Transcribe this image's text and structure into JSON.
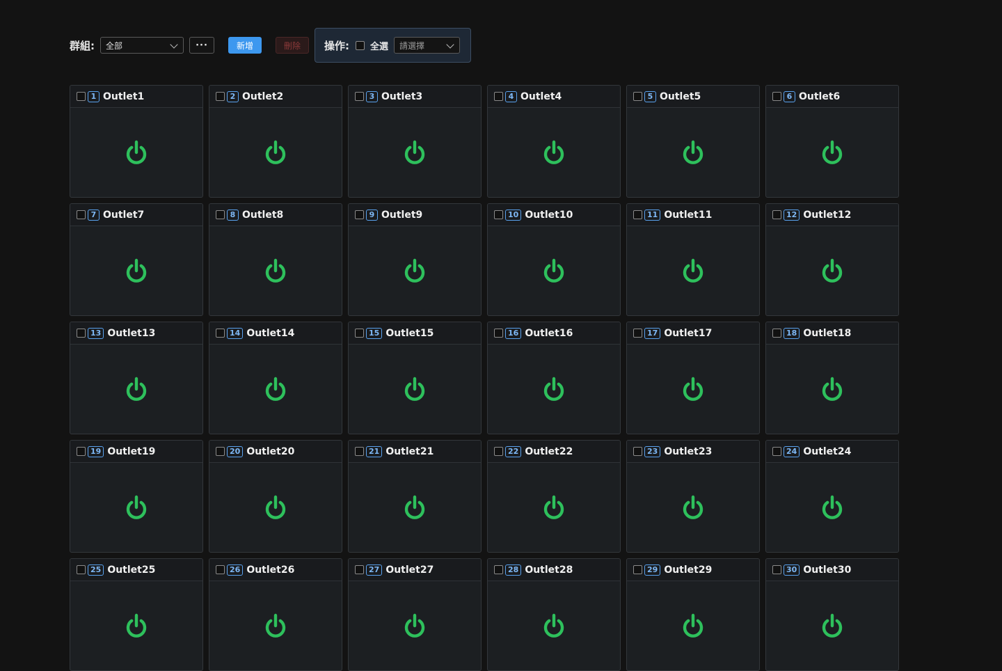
{
  "toolbar": {
    "group_label": "群組:",
    "group_value": "全部",
    "more_label": "···",
    "add_label": "新增",
    "delete_label": "刪除",
    "operation_label": "操作:",
    "select_all_label": "全選",
    "operation_placeholder": "請選擇"
  },
  "colors": {
    "power_on": "#2ec05c",
    "badge": "#5aa3f0",
    "add_button": "#3d98ef"
  },
  "icons": {
    "power": "power-icon",
    "chevron": "chevron-down-icon"
  },
  "outlets": [
    {
      "num": "1",
      "name": "Outlet1"
    },
    {
      "num": "2",
      "name": "Outlet2"
    },
    {
      "num": "3",
      "name": "Outlet3"
    },
    {
      "num": "4",
      "name": "Outlet4"
    },
    {
      "num": "5",
      "name": "Outlet5"
    },
    {
      "num": "6",
      "name": "Outlet6"
    },
    {
      "num": "7",
      "name": "Outlet7"
    },
    {
      "num": "8",
      "name": "Outlet8"
    },
    {
      "num": "9",
      "name": "Outlet9"
    },
    {
      "num": "10",
      "name": "Outlet10"
    },
    {
      "num": "11",
      "name": "Outlet11"
    },
    {
      "num": "12",
      "name": "Outlet12"
    },
    {
      "num": "13",
      "name": "Outlet13"
    },
    {
      "num": "14",
      "name": "Outlet14"
    },
    {
      "num": "15",
      "name": "Outlet15"
    },
    {
      "num": "16",
      "name": "Outlet16"
    },
    {
      "num": "17",
      "name": "Outlet17"
    },
    {
      "num": "18",
      "name": "Outlet18"
    },
    {
      "num": "19",
      "name": "Outlet19"
    },
    {
      "num": "20",
      "name": "Outlet20"
    },
    {
      "num": "21",
      "name": "Outlet21"
    },
    {
      "num": "22",
      "name": "Outlet22"
    },
    {
      "num": "23",
      "name": "Outlet23"
    },
    {
      "num": "24",
      "name": "Outlet24"
    },
    {
      "num": "25",
      "name": "Outlet25"
    },
    {
      "num": "26",
      "name": "Outlet26"
    },
    {
      "num": "27",
      "name": "Outlet27"
    },
    {
      "num": "28",
      "name": "Outlet28"
    },
    {
      "num": "29",
      "name": "Outlet29"
    },
    {
      "num": "30",
      "name": "Outlet30"
    }
  ]
}
